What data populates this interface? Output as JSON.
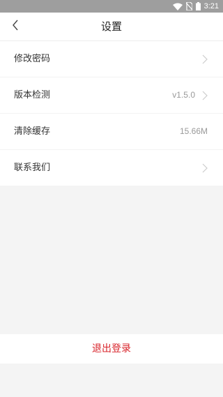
{
  "status_bar": {
    "time": "3:21",
    "icons": [
      "wifi-icon",
      "no-sim-icon",
      "battery-icon"
    ]
  },
  "header": {
    "title": "设置",
    "back_icon": "chevron-left-icon"
  },
  "settings": {
    "items": [
      {
        "label": "修改密码",
        "value": ""
      },
      {
        "label": "版本检测",
        "value": "v1.5.0"
      },
      {
        "label": "清除缓存",
        "value": "15.66M"
      },
      {
        "label": "联系我们",
        "value": ""
      }
    ]
  },
  "logout": {
    "label": "退出登录",
    "color": "#d8232a"
  },
  "colors": {
    "status_bar": "#9e9e9e",
    "background": "#f4f4f4",
    "accent": "#d8232a"
  }
}
